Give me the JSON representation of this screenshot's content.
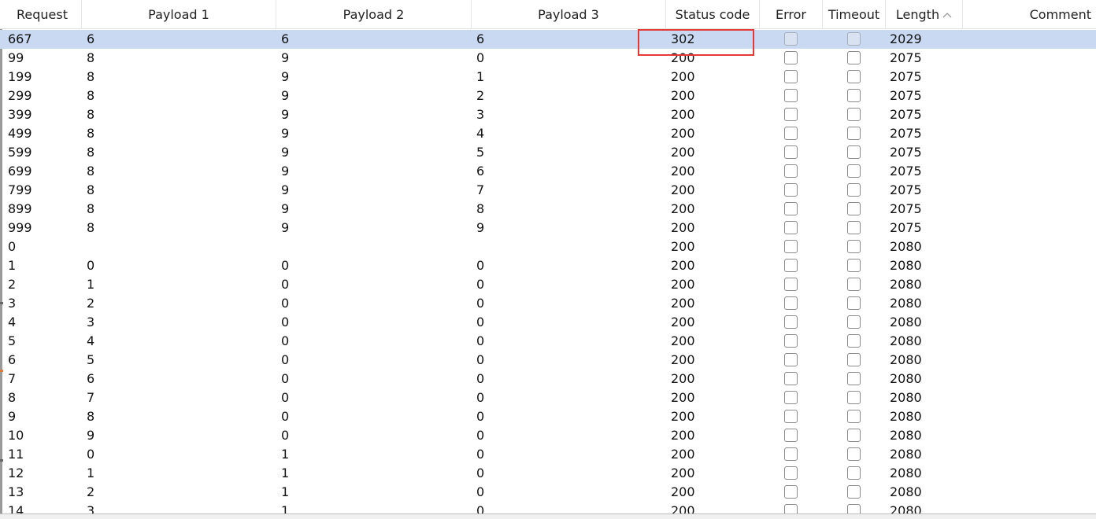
{
  "columns": {
    "request": "Request",
    "payload1": "Payload 1",
    "payload2": "Payload 2",
    "payload3": "Payload 3",
    "status": "Status code",
    "error": "Error",
    "timeout": "Timeout",
    "length": "Length",
    "comment": "Comment"
  },
  "sort": {
    "column": "length",
    "direction": "ascending",
    "icon": "chevron-up-icon"
  },
  "highlight_color": "#e53935",
  "selected_row_color": "#c9d9f1",
  "rows": [
    {
      "request": "667",
      "p1": "6",
      "p2": "6",
      "p3": "6",
      "status": "302",
      "error": false,
      "timeout": false,
      "length": "2029",
      "comment": "",
      "selected": true
    },
    {
      "request": "99",
      "p1": "8",
      "p2": "9",
      "p3": "0",
      "status": "200",
      "error": false,
      "timeout": false,
      "length": "2075",
      "comment": ""
    },
    {
      "request": "199",
      "p1": "8",
      "p2": "9",
      "p3": "1",
      "status": "200",
      "error": false,
      "timeout": false,
      "length": "2075",
      "comment": ""
    },
    {
      "request": "299",
      "p1": "8",
      "p2": "9",
      "p3": "2",
      "status": "200",
      "error": false,
      "timeout": false,
      "length": "2075",
      "comment": ""
    },
    {
      "request": "399",
      "p1": "8",
      "p2": "9",
      "p3": "3",
      "status": "200",
      "error": false,
      "timeout": false,
      "length": "2075",
      "comment": ""
    },
    {
      "request": "499",
      "p1": "8",
      "p2": "9",
      "p3": "4",
      "status": "200",
      "error": false,
      "timeout": false,
      "length": "2075",
      "comment": ""
    },
    {
      "request": "599",
      "p1": "8",
      "p2": "9",
      "p3": "5",
      "status": "200",
      "error": false,
      "timeout": false,
      "length": "2075",
      "comment": ""
    },
    {
      "request": "699",
      "p1": "8",
      "p2": "9",
      "p3": "6",
      "status": "200",
      "error": false,
      "timeout": false,
      "length": "2075",
      "comment": ""
    },
    {
      "request": "799",
      "p1": "8",
      "p2": "9",
      "p3": "7",
      "status": "200",
      "error": false,
      "timeout": false,
      "length": "2075",
      "comment": ""
    },
    {
      "request": "899",
      "p1": "8",
      "p2": "9",
      "p3": "8",
      "status": "200",
      "error": false,
      "timeout": false,
      "length": "2075",
      "comment": ""
    },
    {
      "request": "999",
      "p1": "8",
      "p2": "9",
      "p3": "9",
      "status": "200",
      "error": false,
      "timeout": false,
      "length": "2075",
      "comment": ""
    },
    {
      "request": "0",
      "p1": "",
      "p2": "",
      "p3": "",
      "status": "200",
      "error": false,
      "timeout": false,
      "length": "2080",
      "comment": ""
    },
    {
      "request": "1",
      "p1": "0",
      "p2": "0",
      "p3": "0",
      "status": "200",
      "error": false,
      "timeout": false,
      "length": "2080",
      "comment": ""
    },
    {
      "request": "2",
      "p1": "1",
      "p2": "0",
      "p3": "0",
      "status": "200",
      "error": false,
      "timeout": false,
      "length": "2080",
      "comment": ""
    },
    {
      "request": "3",
      "p1": "2",
      "p2": "0",
      "p3": "0",
      "status": "200",
      "error": false,
      "timeout": false,
      "length": "2080",
      "comment": ""
    },
    {
      "request": "4",
      "p1": "3",
      "p2": "0",
      "p3": "0",
      "status": "200",
      "error": false,
      "timeout": false,
      "length": "2080",
      "comment": ""
    },
    {
      "request": "5",
      "p1": "4",
      "p2": "0",
      "p3": "0",
      "status": "200",
      "error": false,
      "timeout": false,
      "length": "2080",
      "comment": ""
    },
    {
      "request": "6",
      "p1": "5",
      "p2": "0",
      "p3": "0",
      "status": "200",
      "error": false,
      "timeout": false,
      "length": "2080",
      "comment": ""
    },
    {
      "request": "7",
      "p1": "6",
      "p2": "0",
      "p3": "0",
      "status": "200",
      "error": false,
      "timeout": false,
      "length": "2080",
      "comment": ""
    },
    {
      "request": "8",
      "p1": "7",
      "p2": "0",
      "p3": "0",
      "status": "200",
      "error": false,
      "timeout": false,
      "length": "2080",
      "comment": ""
    },
    {
      "request": "9",
      "p1": "8",
      "p2": "0",
      "p3": "0",
      "status": "200",
      "error": false,
      "timeout": false,
      "length": "2080",
      "comment": ""
    },
    {
      "request": "10",
      "p1": "9",
      "p2": "0",
      "p3": "0",
      "status": "200",
      "error": false,
      "timeout": false,
      "length": "2080",
      "comment": ""
    },
    {
      "request": "11",
      "p1": "0",
      "p2": "1",
      "p3": "0",
      "status": "200",
      "error": false,
      "timeout": false,
      "length": "2080",
      "comment": ""
    },
    {
      "request": "12",
      "p1": "1",
      "p2": "1",
      "p3": "0",
      "status": "200",
      "error": false,
      "timeout": false,
      "length": "2080",
      "comment": ""
    },
    {
      "request": "13",
      "p1": "2",
      "p2": "1",
      "p3": "0",
      "status": "200",
      "error": false,
      "timeout": false,
      "length": "2080",
      "comment": ""
    },
    {
      "request": "14",
      "p1": "3",
      "p2": "1",
      "p3": "0",
      "status": "200",
      "error": false,
      "timeout": false,
      "length": "2080",
      "comment": ""
    }
  ]
}
